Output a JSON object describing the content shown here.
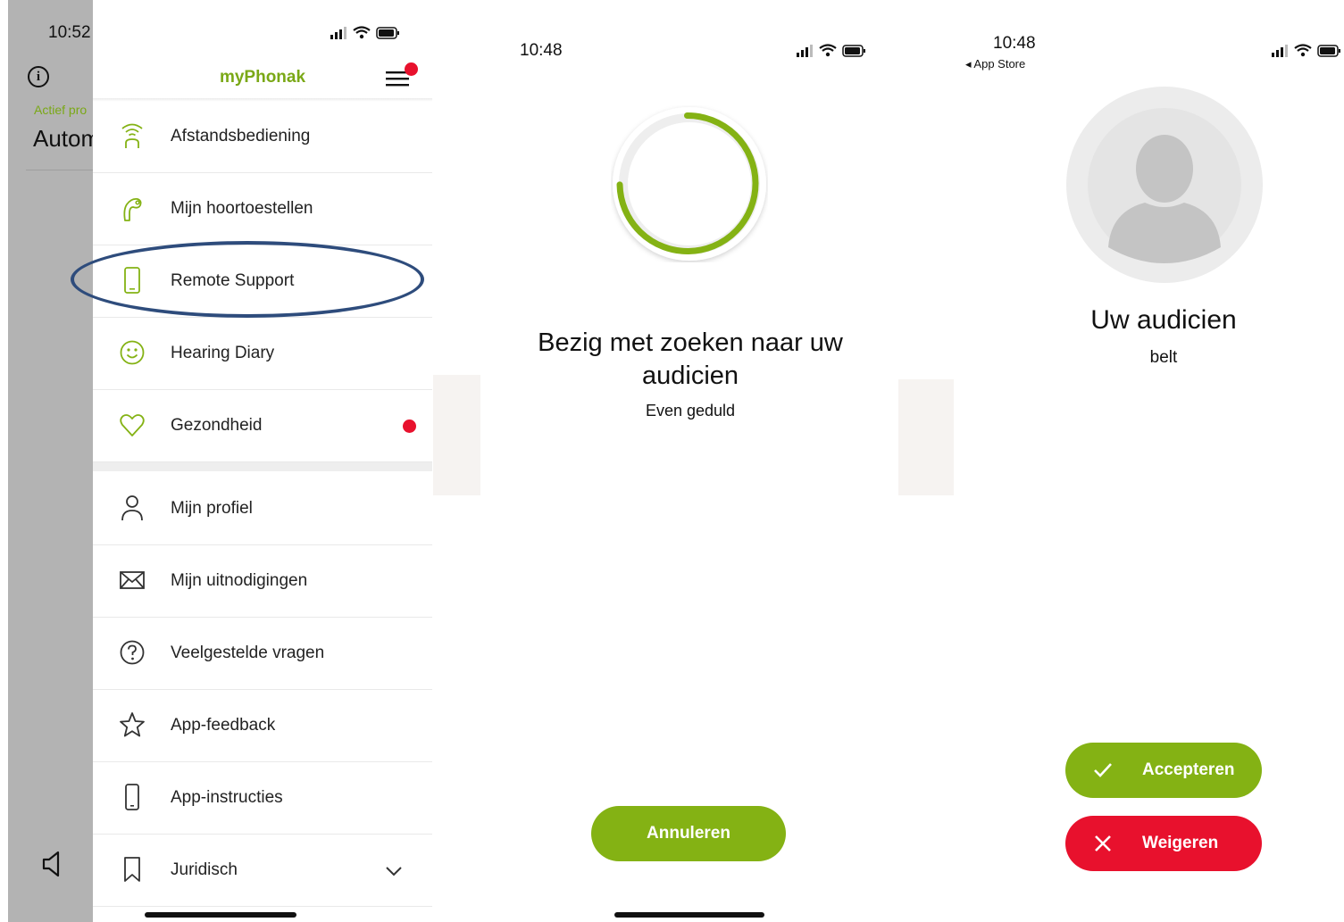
{
  "panel1": {
    "background_app": {
      "time": "10:52",
      "actief_label": "Actief pro",
      "program": "Autom"
    },
    "menu": {
      "app_title": "myPhonak",
      "items": [
        {
          "label": "Afstandsbediening",
          "icon": "remote-signal-icon"
        },
        {
          "label": "Mijn hoortoestellen",
          "icon": "hearing-aid-icon"
        },
        {
          "label": "Remote Support",
          "icon": "phone-icon"
        },
        {
          "label": "Hearing Diary",
          "icon": "smiley-icon"
        },
        {
          "label": "Gezondheid",
          "icon": "heart-icon"
        },
        {
          "label": "Mijn profiel",
          "icon": "person-icon"
        },
        {
          "label": "Mijn uitnodigingen",
          "icon": "envelope-icon"
        },
        {
          "label": "Veelgestelde vragen",
          "icon": "question-icon"
        },
        {
          "label": "App-feedback",
          "icon": "star-icon"
        },
        {
          "label": "App-instructies",
          "icon": "phone-outline-icon"
        },
        {
          "label": "Juridisch",
          "icon": "bookmark-icon"
        }
      ]
    }
  },
  "panel2": {
    "time": "10:48",
    "heading": "Bezig met zoeken naar uw audicien",
    "subtext": "Even geduld",
    "cancel_label": "Annuleren"
  },
  "panel3": {
    "time": "10:48",
    "back_label": "◂ App Store",
    "caller_name": "Uw audicien",
    "caller_status": "belt",
    "accept_label": "Accepteren",
    "reject_label": "Weigeren"
  },
  "colors": {
    "brand_green": "#84b214",
    "title_green": "#7aa816",
    "alert_red": "#e8112d",
    "highlight_blue": "#2e4c7c"
  }
}
